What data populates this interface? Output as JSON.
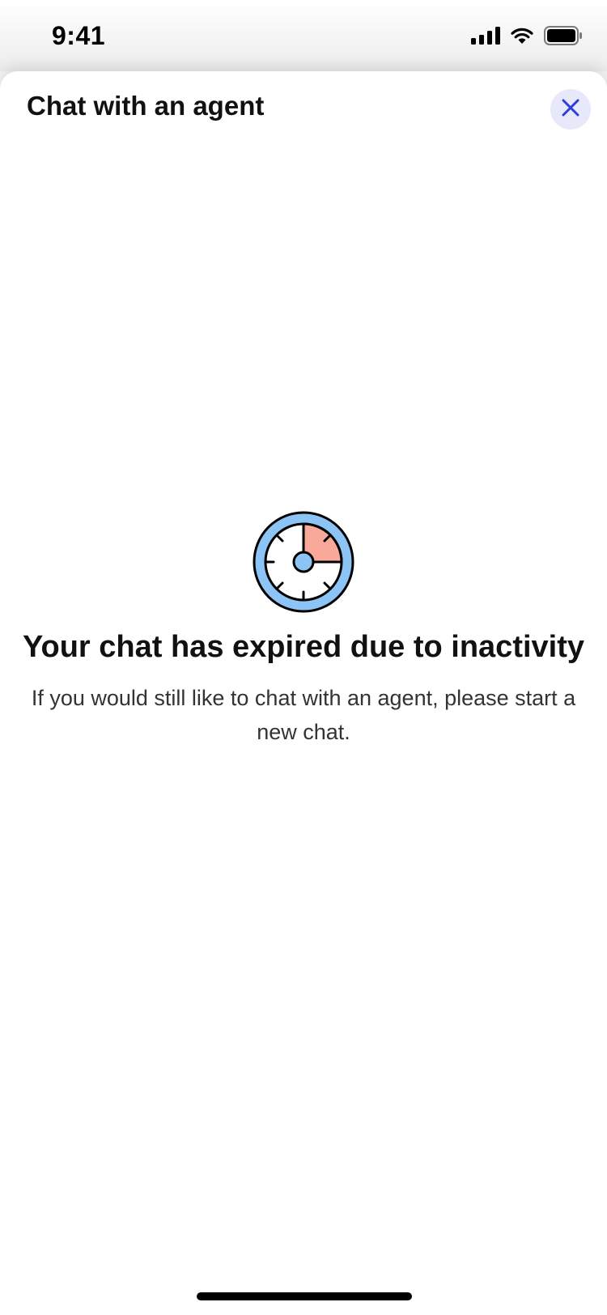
{
  "status_bar": {
    "time": "9:41",
    "icons": [
      "signal-icon",
      "wifi-icon",
      "battery-icon"
    ]
  },
  "sheet": {
    "title": "Chat with an agent",
    "close_icon": "close-icon"
  },
  "message": {
    "illustration": "timer-icon",
    "title": "Your chat has expired due to inactivity",
    "body": "If you would still like to chat with an agent, please start a new chat."
  },
  "colors": {
    "accent": "#2b3fdc",
    "close_bg": "#e7e9fb",
    "timer_ring": "#8cc4f5",
    "timer_wedge": "#f9a99a"
  }
}
